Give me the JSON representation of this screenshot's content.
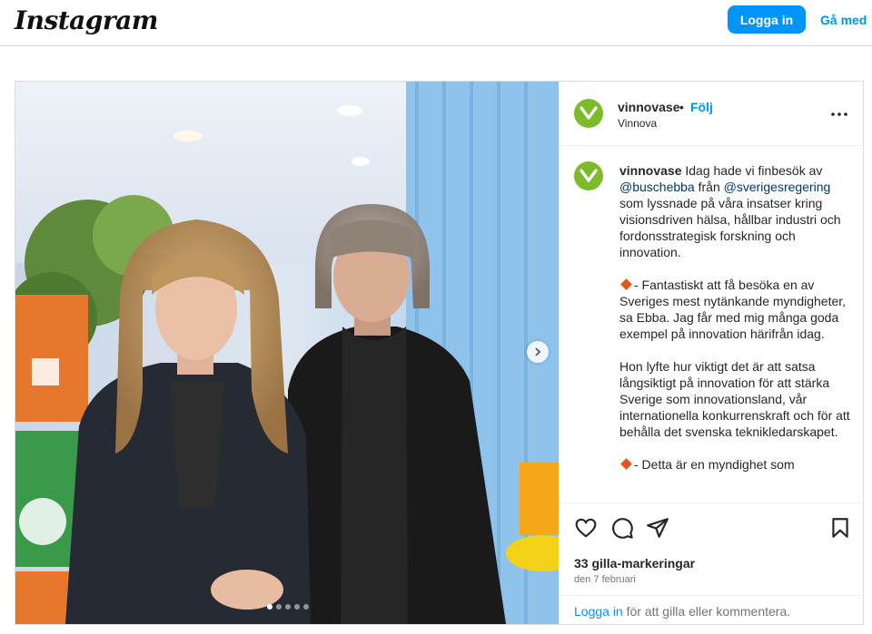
{
  "header": {
    "logo_text": "Instagram",
    "login_label": "Logga in",
    "signup_label": "Gå med"
  },
  "post": {
    "username": "vinnovase",
    "bullet": "•",
    "follow_label": "Följ",
    "subtitle": "Vinnova",
    "image_alt": "Two women standing indoors",
    "carousel": {
      "total": 5,
      "active_index": 0
    },
    "caption": {
      "username": "vinnovase",
      "p1_a": " Idag hade vi finbesök av ",
      "mention1": "@buschebba",
      "p1_b": " från ",
      "mention2": "@sverigesregering",
      "p1_c": " som lyssnade på våra insatser kring visionsdriven hälsa, hållbar industri och fordonsstrategisk forskning och innovation.",
      "p2": "- Fantastiskt att få besöka en av Sveriges mest nytänkande myndigheter, sa Ebba. Jag får med mig många goda exempel på innovation härifrån idag.",
      "p3": "Hon lyfte hur viktigt det är att satsa långsiktigt på innovation för att stärka Sverige som innovationsland, vår internationella konkurrenskraft och för att behålla det svenska teknikledarskapet.",
      "p4": "- Detta är en myndighet som"
    },
    "likes_text": "33 gilla-markeringar",
    "date_text": "den 7 februari",
    "login_prompt": {
      "link": "Logga in",
      "rest": " för att gilla eller kommentera."
    }
  },
  "colors": {
    "accent": "#0095f6",
    "avatar_green": "#7cbc2c",
    "diamond_orange": "#e2561d"
  },
  "icons": [
    "heart-icon",
    "comment-icon",
    "share-icon",
    "bookmark-icon",
    "more-options-icon",
    "chevron-right-icon",
    "vinnova-v-logo"
  ]
}
